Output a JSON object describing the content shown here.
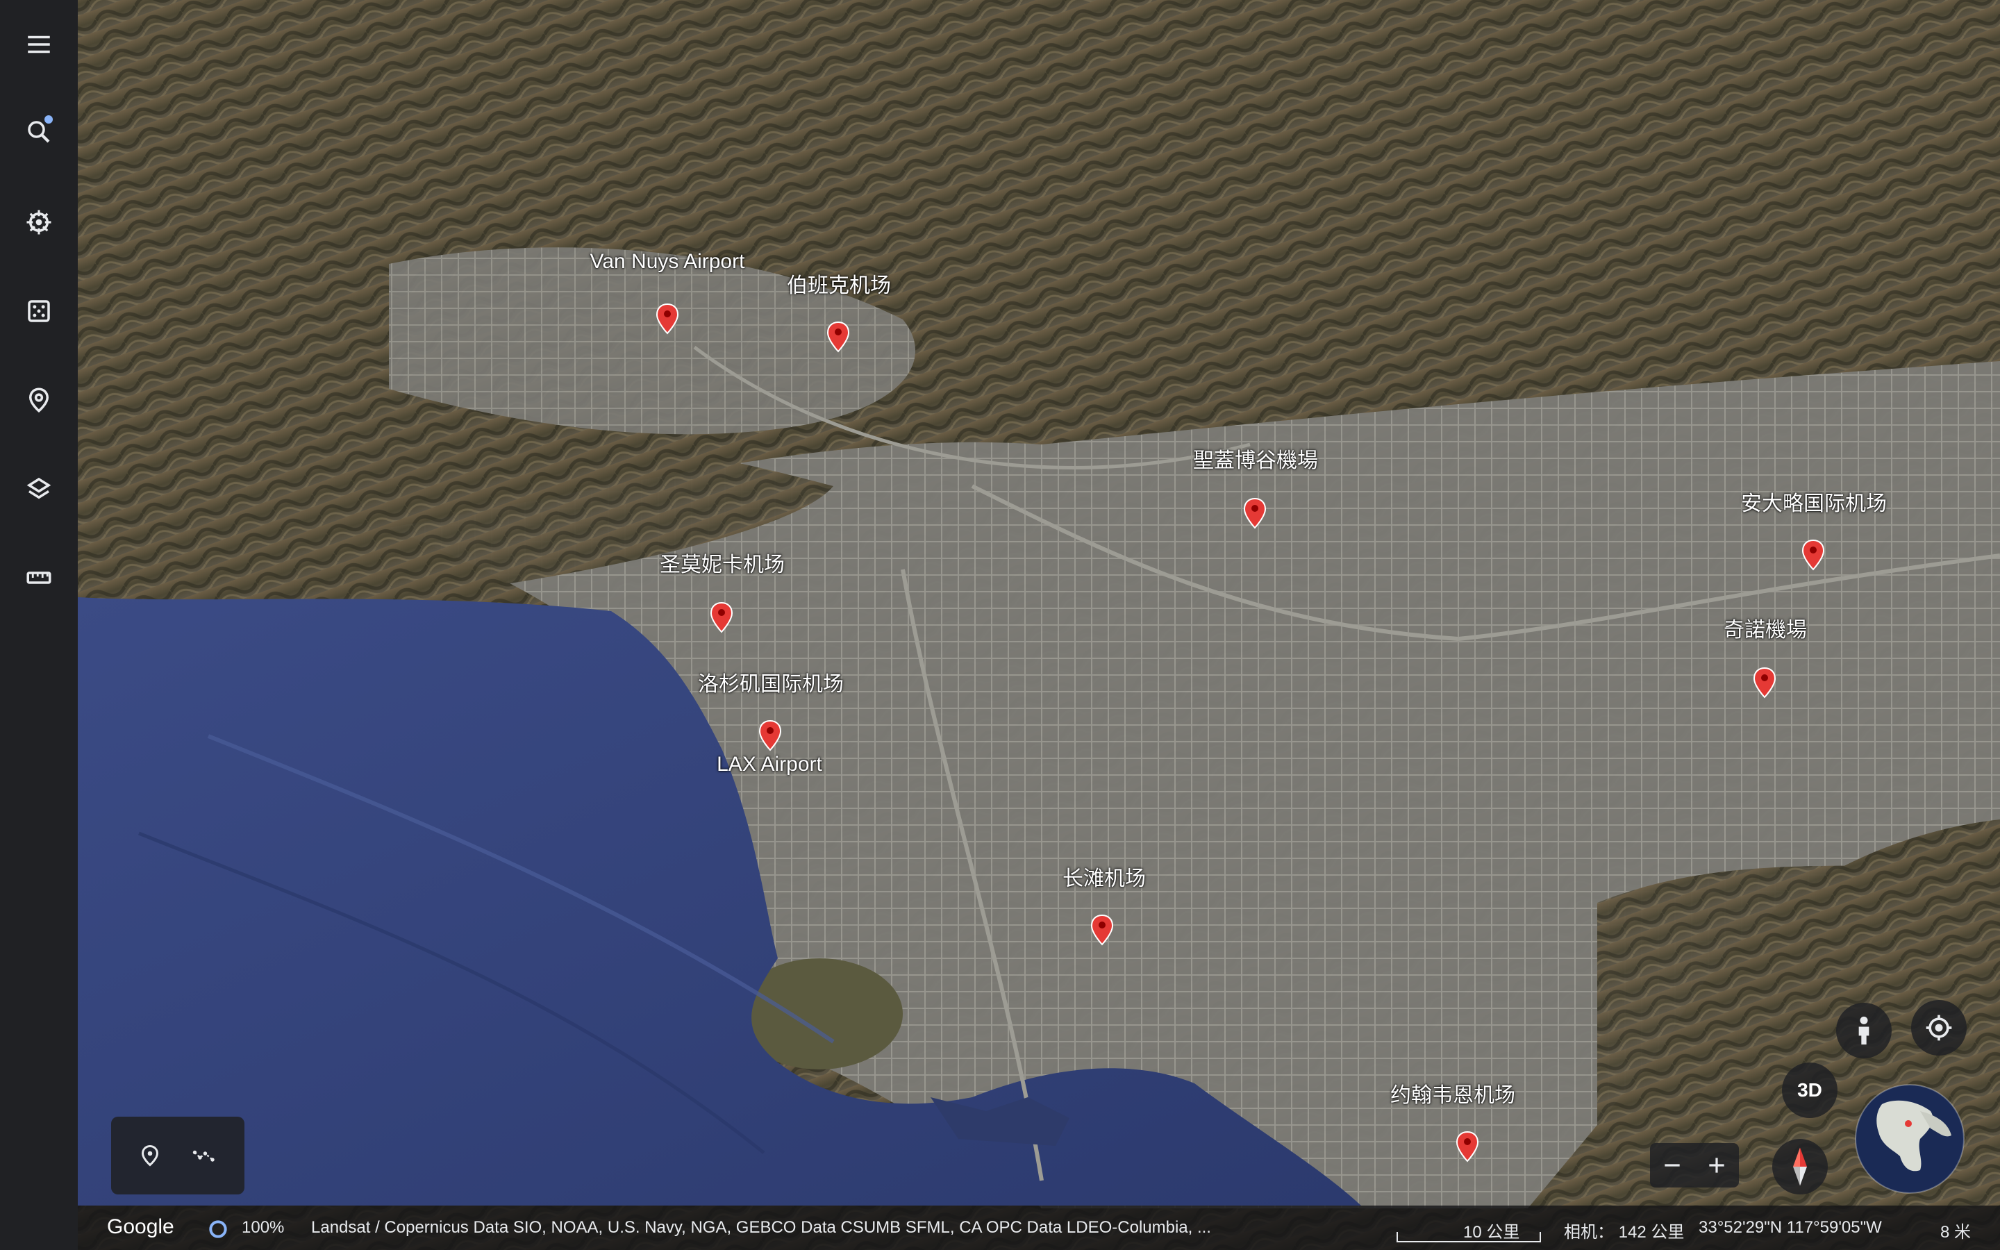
{
  "sidebar": {
    "items": [
      {
        "icon": "menu-icon"
      },
      {
        "icon": "search-icon",
        "notification": true
      },
      {
        "icon": "voyager-icon"
      },
      {
        "icon": "feeling-lucky-icon"
      },
      {
        "icon": "projects-icon"
      },
      {
        "icon": "map-style-icon"
      },
      {
        "icon": "measure-icon"
      }
    ]
  },
  "map": {
    "places": [
      {
        "name": "Van Nuys Airport"
      },
      {
        "name": "伯班克机场"
      },
      {
        "name": "聖蓋博谷機場"
      },
      {
        "name": "安大略国际机场"
      },
      {
        "name": "圣莫妮卡机场"
      },
      {
        "name": "洛杉矶国际机场"
      },
      {
        "name": "LAX Airport"
      },
      {
        "name": "奇諾機場"
      },
      {
        "name": "长滩机场"
      },
      {
        "name": "约翰韦恩机场"
      }
    ],
    "marker_color": "#e53935",
    "ocean_color": "#3d4f8c"
  },
  "controls": {
    "view_3d_label": "3D",
    "zoom_out": "−",
    "zoom_in": "+"
  },
  "statusbar": {
    "logo": "Google",
    "loading": "100%",
    "attribution": "Landsat / Copernicus   Data SIO, NOAA, U.S. Navy, NGA, GEBCO   Data CSUMB SFML, CA OPC   Data LDEO-Columbia, ...",
    "scale": "10 公里",
    "camera": "相机： 142 公里",
    "coordinates": "33°52'29\"N 117°59'05\"W",
    "elevation": "8 米"
  }
}
